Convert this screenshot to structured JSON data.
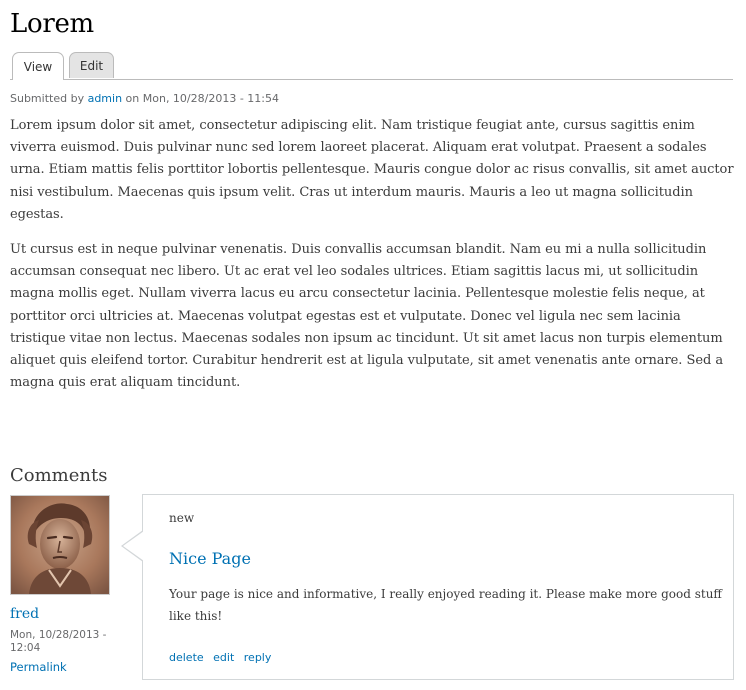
{
  "page": {
    "title": "Lorem",
    "tabs": [
      {
        "label": "View",
        "active": true
      },
      {
        "label": "Edit",
        "active": false
      }
    ]
  },
  "submitted": {
    "prefix": "Submitted by",
    "author": "admin",
    "on": "on Mon, 10/28/2013 - 11:54"
  },
  "body": {
    "paragraphs": [
      "Lorem ipsum dolor sit amet, consectetur adipiscing elit. Nam tristique feugiat ante, cursus sagittis enim viverra euismod. Duis pulvinar nunc sed lorem laoreet placerat. Aliquam erat volutpat. Praesent a sodales urna. Etiam mattis felis porttitor lobortis pellentesque. Mauris congue dolor ac risus convallis, sit amet auctor nisi vestibulum. Maecenas quis ipsum velit. Cras ut interdum mauris. Mauris a leo ut magna sollicitudin egestas.",
      "Ut cursus est in neque pulvinar venenatis. Duis convallis accumsan blandit. Nam eu mi a nulla sollicitudin accumsan consequat nec libero. Ut ac erat vel leo sodales ultrices. Etiam sagittis lacus mi, ut sollicitudin magna mollis eget. Nullam viverra lacus eu arcu consectetur lacinia. Pellentesque molestie felis neque, at porttitor orci ultricies at. Maecenas volutpat egestas est et vulputate. Donec vel ligula nec sem lacinia tristique vitae non lectus. Maecenas sodales non ipsum ac tincidunt. Ut sit amet lacus non turpis elementum aliquet quis eleifend tortor. Curabitur hendrerit est at ligula vulputate, sit amet venenatis ante ornare. Sed a magna quis erat aliquam tincidunt."
    ]
  },
  "comments": {
    "heading": "Comments",
    "items": [
      {
        "author": "fred",
        "date": "Mon, 10/28/2013 - 12:04",
        "permalink": "Permalink",
        "new_mark": "new",
        "title": "Nice Page",
        "text": "Your page is nice and informative, I really enjoyed reading it. Please make more good stuff like this!",
        "links": {
          "delete": "delete",
          "edit": "edit",
          "reply": "reply"
        }
      }
    ]
  },
  "colors": {
    "link": "#0071b3",
    "text": "#3b3b3b",
    "meta": "#68696b"
  },
  "icons": {
    "avatar": "user-portrait-avatar"
  }
}
